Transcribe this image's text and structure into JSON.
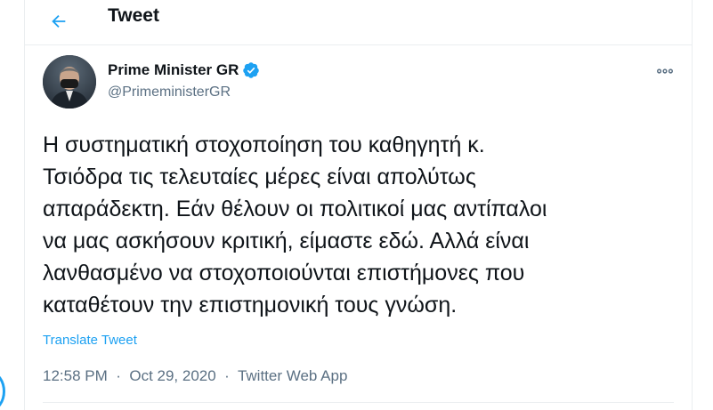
{
  "header": {
    "title": "Tweet",
    "back_icon": "arrow-left-icon"
  },
  "tweet": {
    "author_name": "Prime Minister GR",
    "author_handle": "@PrimeministerGR",
    "verified_icon": "verified-badge-icon",
    "more_icon": "more-horizontal-icon",
    "text_lines": [
      "Η συστηματική στοχοποίηση του καθηγητή κ.",
      "Τσιόδρα τις τελευταίες μέρες είναι απολύτως",
      "απαράδεκτη. Εάν θέλουν οι πολιτικοί μας αντίπαλοι",
      "να μας ασκήσουν κριτική, είμαστε εδώ. Αλλά είναι",
      "λανθασμένο να στοχοποιούνται επιστήμονες που",
      "καταθέτουν την επιστημονική τους γνώση."
    ],
    "translate_label": "Translate Tweet",
    "time": "12:58 PM",
    "separator": "·",
    "date": "Oct 29, 2020",
    "source": "Twitter Web App"
  },
  "colors": {
    "accent": "#1da1f2",
    "text": "#0f1419",
    "secondary": "#5b7083",
    "border": "#ebeef0"
  }
}
